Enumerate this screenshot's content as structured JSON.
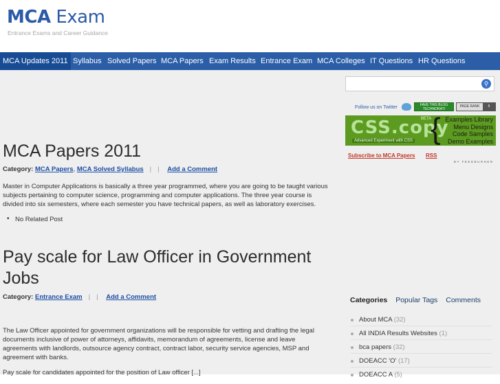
{
  "site": {
    "logo_bold": "MCA",
    "logo_rest": " Exam",
    "tagline": "Entrance Exams and Career Guidance"
  },
  "nav": {
    "items": [
      {
        "label": "MCA Updates 2011"
      },
      {
        "label": "Syllabus"
      },
      {
        "label": "Solved Papers"
      },
      {
        "label": "MCA Papers"
      },
      {
        "label": "Exam Results"
      },
      {
        "label": "Entrance Exam"
      },
      {
        "label": "MCA Colleges"
      },
      {
        "label": "IT Questions"
      },
      {
        "label": "HR Questions"
      }
    ]
  },
  "posts": [
    {
      "title": "MCA Papers 2011",
      "category_label": "Category:",
      "categories": [
        "MCA Papers",
        "MCA Solved Syllabus"
      ],
      "comment_link": "Add a Comment",
      "excerpt": "Master in Computer Applications is basically a three year programmed, where you are going to be taught various subjects pertaining to computer science, programming and computer applications. The three year course is divided into six semesters, where each semester you have technical papers, as well as laboratory exercises.",
      "related": "No Related Post"
    },
    {
      "title": "Pay scale for Law Officer in Government Jobs",
      "category_label": "Category:",
      "categories": [
        "Entrance Exam"
      ],
      "comment_link": "Add a Comment",
      "excerpt": "The Law Officer appointed for government organizations will be responsible for vetting and drafting the legal documents inclusive of power of attorneys, affidavits, memorandum of agreements, license and leave agreements with landlords, outsource agency contract, contract labor, security service agencies, MSP and agreement with banks.",
      "excerpt2": "Pay scale for candidates appointed for the position of Law officer [...]"
    }
  ],
  "sidebar": {
    "search_placeholder": "",
    "follow_text": "Follow us on Twitter",
    "badge_technorati": "FAVE THIS BLOG TECHNORATI",
    "pagerank_label": "PAGE RANK",
    "pagerank_value": "5",
    "css_logo": "CSS.copy",
    "css_beta": "BETA",
    "css_sub": "Advanced Experiment with CSS",
    "css_lines": [
      "Examples Library",
      "Menu Designs",
      "Code Samples",
      "Demo Examples"
    ],
    "subscribe": "Subscribe to MCA Papers",
    "rss": "RSS",
    "feedburner": "BY FEEDBURNER",
    "tabs": [
      "Categories",
      "Popular Tags",
      "Comments"
    ],
    "categories": [
      {
        "name": "About MCA",
        "count": "(32)"
      },
      {
        "name": "All INDIA Results Websites",
        "count": "(1)"
      },
      {
        "name": "bca papers",
        "count": "(32)"
      },
      {
        "name": "DOEACC 'O'",
        "count": "(17)"
      },
      {
        "name": "DOEACC A",
        "count": "(5)"
      }
    ]
  },
  "colors": {
    "nav_bg": "#2b5ea7",
    "nav_active": "#174b94",
    "link": "#1c4ea3",
    "content_bg": "#efefef"
  }
}
